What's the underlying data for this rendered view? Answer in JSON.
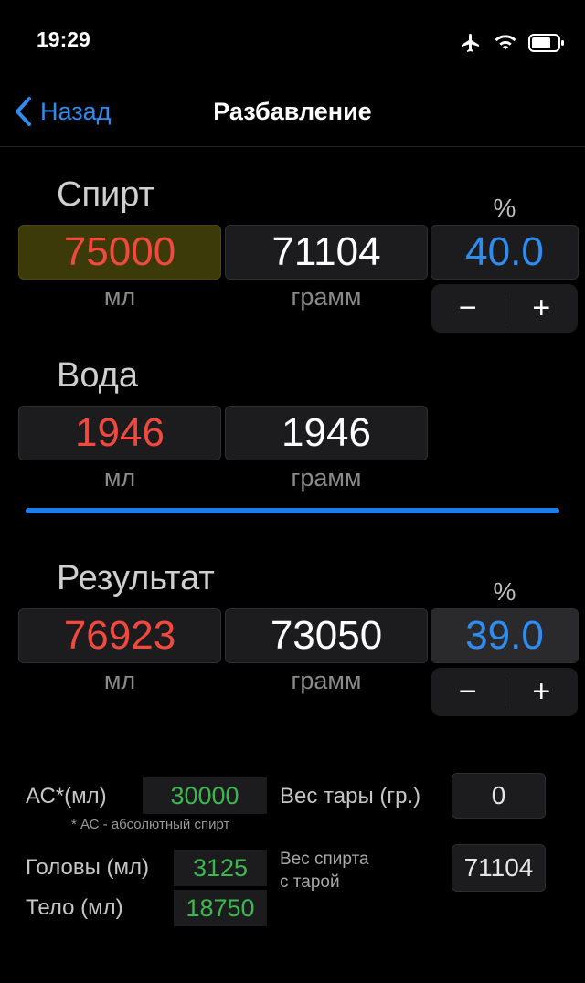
{
  "status_bar": {
    "time": "19:29"
  },
  "nav": {
    "back_label": "Назад",
    "title": "Разбавление"
  },
  "alcohol": {
    "label": "Спирт",
    "ml": "75000",
    "grams": "71104",
    "percent_label": "%",
    "percent": "40.0",
    "unit_ml": "мл",
    "unit_grams": "грамм"
  },
  "water": {
    "label": "Вода",
    "ml": "1946",
    "grams": "1946",
    "unit_ml": "мл",
    "unit_grams": "грамм"
  },
  "result": {
    "label": "Результат",
    "ml": "76923",
    "grams": "73050",
    "percent_label": "%",
    "percent": "39.0",
    "unit_ml": "мл",
    "unit_grams": "грамм"
  },
  "stepper": {
    "minus": "−",
    "plus": "+"
  },
  "summary": {
    "as_label": "АС*(мл)",
    "as_value": "30000",
    "as_note": "* АС - абсолютный спирт",
    "tare_label": "Вес тары (гр.)",
    "tare_value": "0",
    "heads_label": "Головы (мл)",
    "heads_value": "3125",
    "body_label": "Тело (мл)",
    "body_value": "18750",
    "weight_with_tare_line1": "Вес спирта",
    "weight_with_tare_line2": "с тарой",
    "weight_with_tare_value": "71104"
  },
  "colors": {
    "accent": "#2f8cf0",
    "red": "#f2493f",
    "green": "#3cb850",
    "highlight": "#3d3a0a"
  }
}
